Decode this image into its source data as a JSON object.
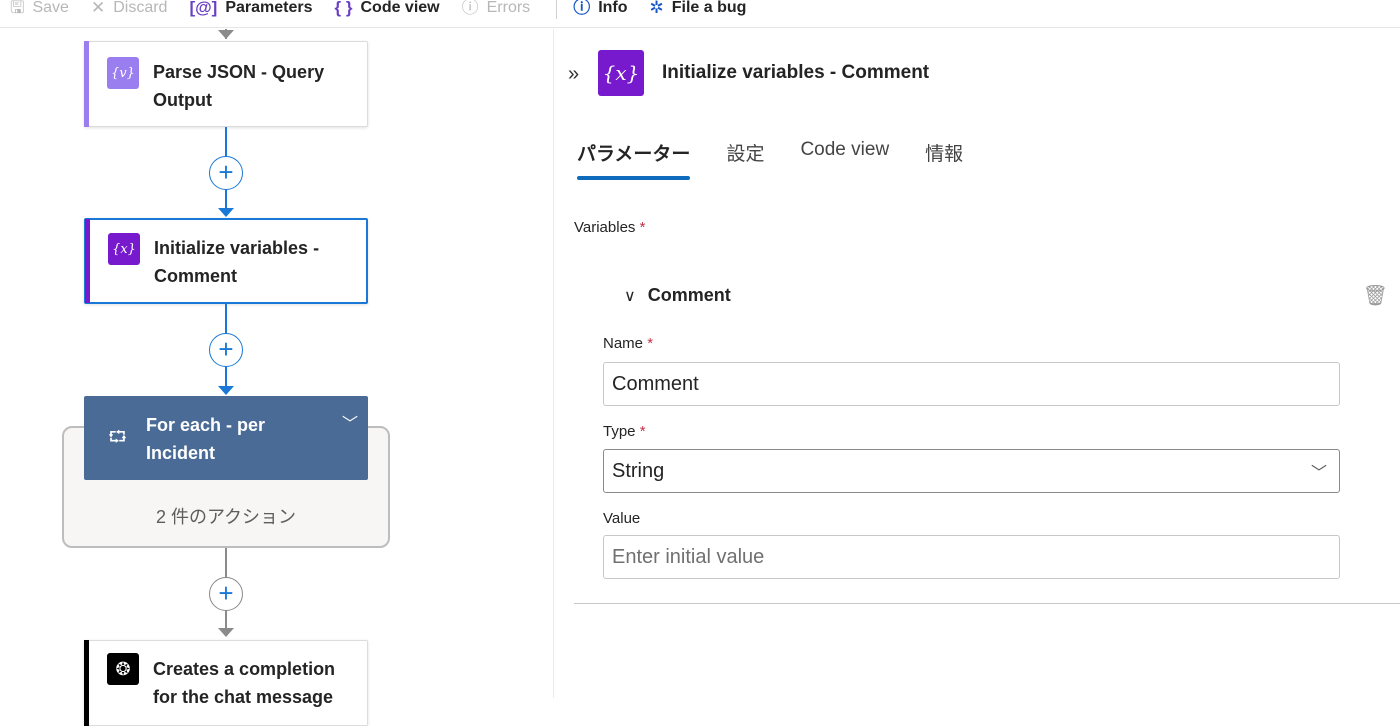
{
  "toolbar": {
    "save": "Save",
    "discard": "Discard",
    "parameters": "Parameters",
    "code_view": "Code view",
    "errors": "Errors",
    "info": "Info",
    "file_bug": "File a bug"
  },
  "canvas": {
    "nodes": [
      {
        "title": "Parse JSON - Query Output",
        "icon": "parse-json-icon",
        "accent": "#9a7ef0"
      },
      {
        "title": "Initialize variables - Comment",
        "icon": "variable-icon",
        "accent": "#7719cc"
      },
      {
        "title": "For each - per Incident",
        "icon": "loop-icon",
        "accent": "#4a6b96"
      },
      {
        "title": "Creates a completion for the chat message",
        "icon": "openai-icon",
        "accent": "#000000"
      }
    ],
    "foreach_count": "2 件のアクション"
  },
  "panel": {
    "title": "Initialize variables - Comment",
    "tabs": [
      "パラメーター",
      "設定",
      "Code view",
      "情報"
    ],
    "active_tab": "パラメーター",
    "variables_label": "Variables",
    "section_title": "Comment",
    "name_label": "Name",
    "name_value": "Comment",
    "type_label": "Type",
    "type_value": "String",
    "value_label": "Value",
    "value_placeholder": "Enter initial value",
    "required_mark": "*"
  }
}
